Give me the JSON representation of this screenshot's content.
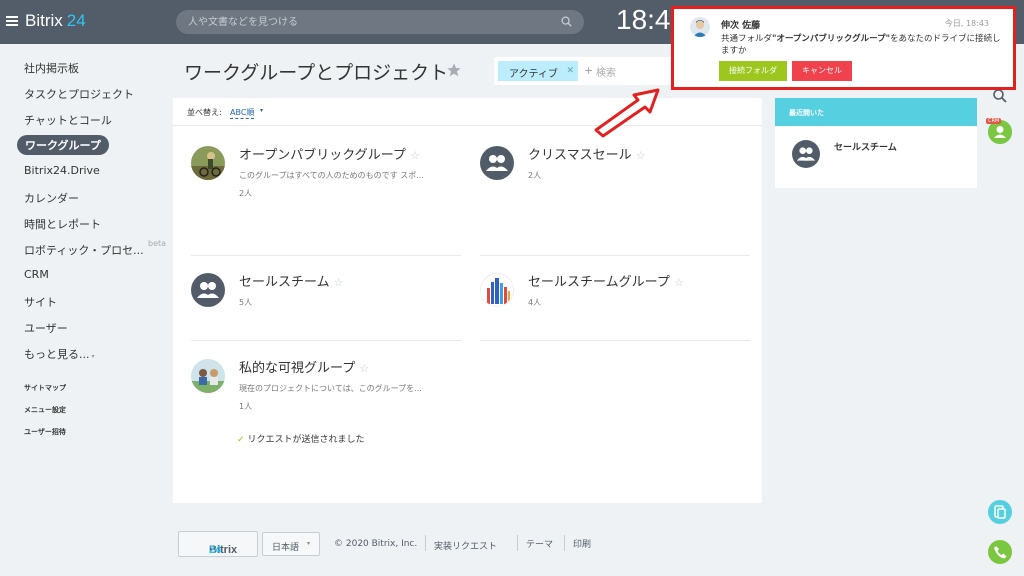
{
  "header": {
    "logo_word": "Bitrix",
    "logo_num": "24",
    "search_placeholder": "人や文書などを見つける",
    "clock": "18:43"
  },
  "sidebar": {
    "items": [
      {
        "label": "社内掲示板"
      },
      {
        "label": "タスクとプロジェクト"
      },
      {
        "label": "チャットとコール"
      },
      {
        "label": "ワークグループ"
      },
      {
        "label": "Bitrix24.Drive"
      },
      {
        "label": "カレンダー"
      },
      {
        "label": "時間とレポート"
      },
      {
        "label": "ロボティック・プロセ..."
      },
      {
        "label": "CRM"
      },
      {
        "label": "サイト"
      },
      {
        "label": "ユーザー"
      },
      {
        "label": "もっと見る..."
      }
    ],
    "beta": "beta",
    "small_links": [
      {
        "label": "サイトマップ"
      },
      {
        "label": "メニュー設定"
      },
      {
        "label": "ユーザー招待"
      }
    ]
  },
  "main": {
    "title": "ワークグループとプロジェクト",
    "filter_tag": "アクティブ",
    "filter_placeholder": "検索",
    "sort_label": "並べ替え:",
    "sort_value": "ABC順",
    "groups": [
      {
        "name": "オープンパブリックグループ",
        "desc": "このグループはすべての人のためのものです スポ...",
        "members": "2人"
      },
      {
        "name": "クリスマスセール",
        "desc": "",
        "members": "2人"
      },
      {
        "name": "セールスチーム",
        "desc": "",
        "members": "5人"
      },
      {
        "name": "セールスチームグループ",
        "desc": "",
        "members": "4人"
      },
      {
        "name": "私的な可視グループ",
        "desc": "現在のプロジェクトについては、このグループを...",
        "members": "1人"
      }
    ],
    "request_sent": "リクエストが送信されました"
  },
  "recent": {
    "header": "最近開いた",
    "item": "セールスチーム"
  },
  "notification": {
    "name": "伸次 佐藤",
    "time": "今日, 18:43",
    "text_pre": "共通フォルダ",
    "text_bold": "\"オープンパブリックグループ\"",
    "text_post": "をあなたのドライブに接続しますか",
    "accept": "接続フォルダ",
    "cancel": "キャンセル"
  },
  "footer": {
    "logo_word": "Bitrix",
    "logo_num": "24",
    "language": "日本語",
    "copyright": "© 2020 Bitrix, Inc.",
    "feature_request": "実装リクエスト",
    "theme": "テーマ",
    "print": "印刷"
  },
  "rail": {
    "crm_badge": "CRM"
  },
  "colors": {
    "header_bg": "#535c69",
    "accent_cyan": "#2fc6f6",
    "notif_border": "#e4201f",
    "accept_green": "#9dc71f",
    "cancel_red": "#f0414c",
    "recent_header": "#56cfe1"
  }
}
